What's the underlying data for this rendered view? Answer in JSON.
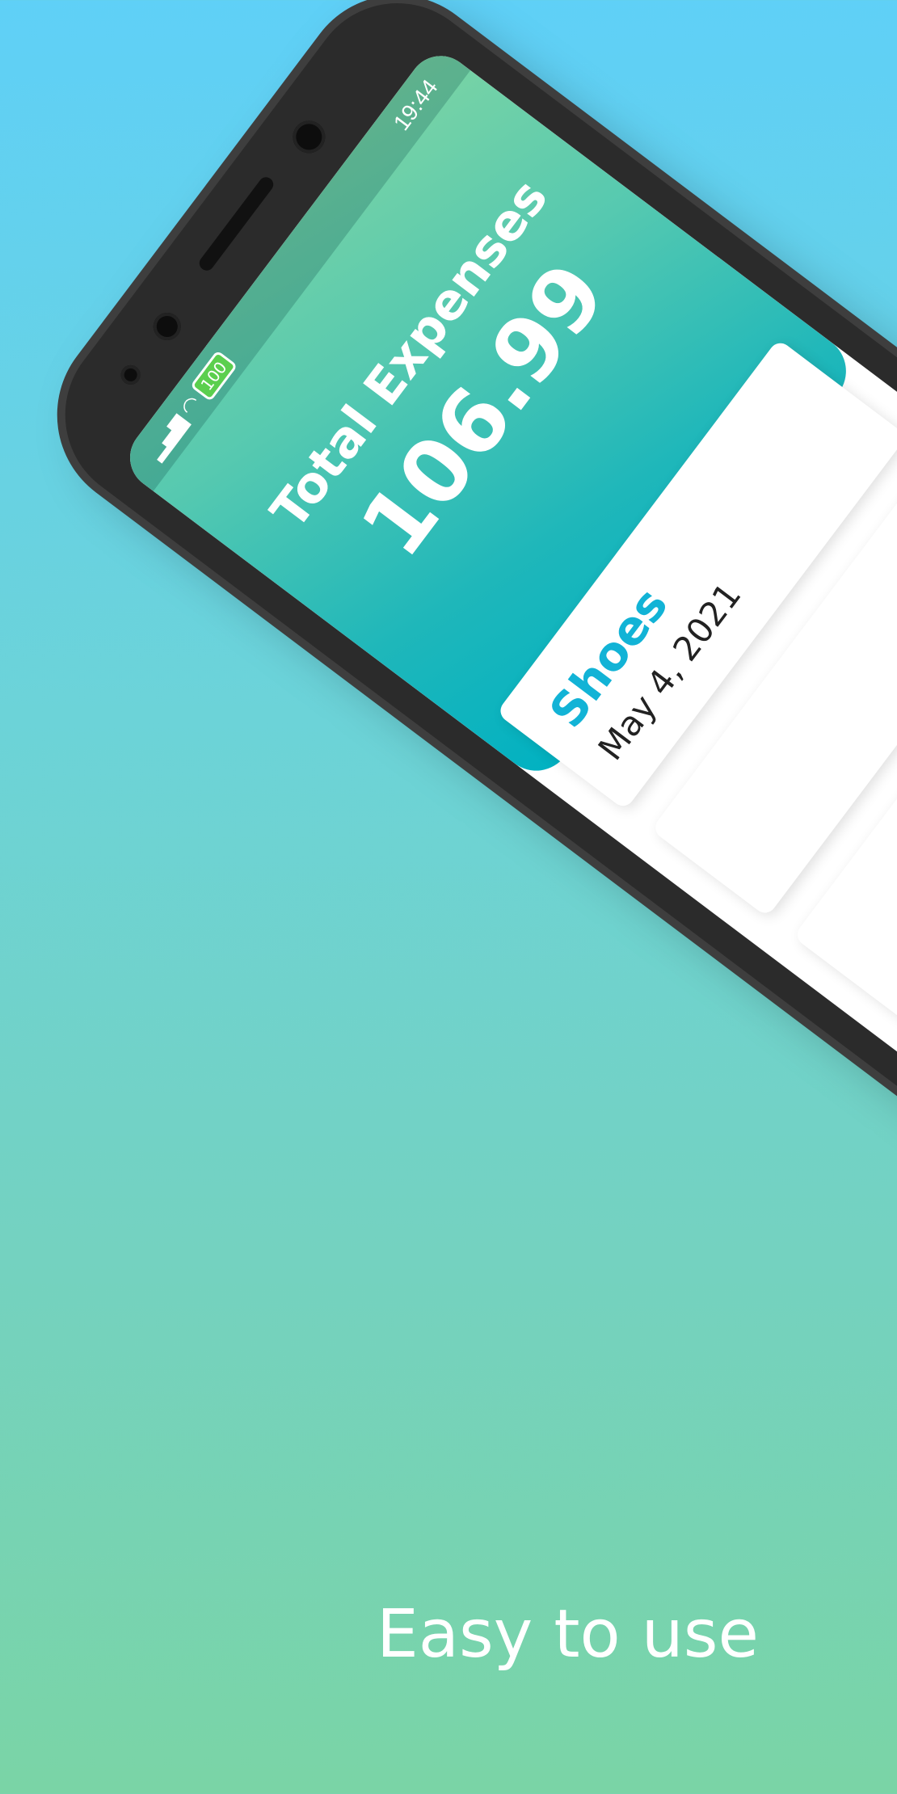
{
  "status_bar": {
    "time": "19:44",
    "battery": "100"
  },
  "summary": {
    "label": "Total Expenses",
    "value": "106.99"
  },
  "expenses": [
    {
      "name": "Shoes",
      "date": "May 4, 2021"
    }
  ],
  "tagline": "Easy to use"
}
